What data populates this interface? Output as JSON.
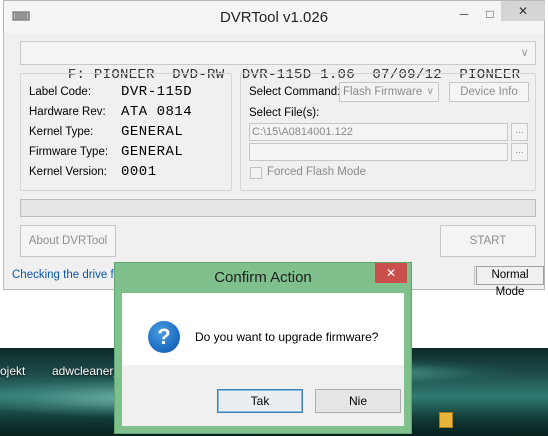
{
  "desktop": {
    "items": [
      {
        "label": "ojekt"
      },
      {
        "label": "adwcleaner_"
      }
    ]
  },
  "window": {
    "title": "DVRTool v1.026",
    "minimize_glyph": "─",
    "maximize_glyph": "□",
    "close_glyph": "✕"
  },
  "drive": {
    "selected": "F: PIONEER  DVD-RW  DVR-115D 1.06  07/09/12  PIONEER"
  },
  "device_info": [
    {
      "label": "Label Code:",
      "value": "DVR-115D"
    },
    {
      "label": "Hardware Rev:",
      "value": "ATA 0814"
    },
    {
      "label": "Kernel Type:",
      "value": "GENERAL"
    },
    {
      "label": "Firmware Type:",
      "value": "GENERAL"
    },
    {
      "label": "Kernel Version:",
      "value": "0001"
    }
  ],
  "command": {
    "select_label": "Select Command:",
    "selected": "Flash Firmware",
    "device_info_button": "Device Info",
    "select_files_label": "Select File(s):",
    "file1": "C:\\15\\A0814001.122",
    "file2": "",
    "browse_label": "...",
    "forced_flash_label": "Forced Flash Mode",
    "forced_flash_checked": false
  },
  "progress": {
    "value": 0
  },
  "buttons": {
    "about": "About DVRTool",
    "start": "START"
  },
  "status": {
    "message": "Checking the drive for",
    "mode": "Normal Mode"
  },
  "dialog": {
    "title": "Confirm Action",
    "close_glyph": "✕",
    "message": "Do you want to upgrade firmware?",
    "icon_glyph": "?",
    "yes_label": "Tak",
    "no_label": "Nie"
  },
  "colors": {
    "status_text": "#0b57a8",
    "dialog_frame": "#7fc08c",
    "dialog_close": "#c9504c",
    "question_icon": "#1e6fc4"
  }
}
